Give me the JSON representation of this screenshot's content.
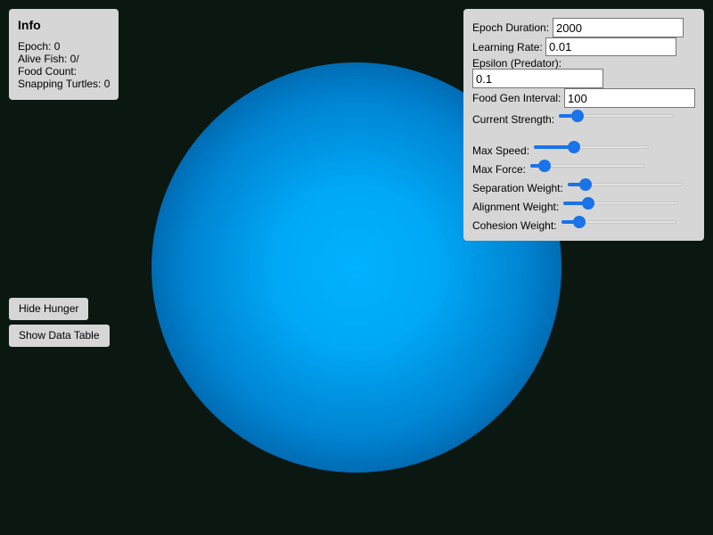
{
  "info": {
    "title": "Info",
    "epoch": "Epoch: 0",
    "alive_fish": "Alive Fish: 0/",
    "food_count": "Food Count:",
    "snapping_turtles": "Snapping Turtles: 0"
  },
  "controls": {
    "epoch_duration": {
      "label": "Epoch Duration:",
      "value": "2000"
    },
    "learning_rate": {
      "label": "Learning Rate:",
      "value": "0.01"
    },
    "epsilon": {
      "label": "Epsilon (Predator):",
      "value": "0.1"
    },
    "food_gen_interval": {
      "label": "Food Gen Interval:",
      "value": "100"
    },
    "current_strength": {
      "label": "Current Strength:",
      "level": 0.12
    },
    "max_speed": {
      "label": "Max Speed:",
      "level": 0.33
    },
    "max_force": {
      "label": "Max Force:",
      "level": 0.08
    },
    "separation_weight": {
      "label": "Separation Weight:",
      "level": 0.11
    },
    "alignment_weight": {
      "label": "Alignment Weight:",
      "level": 0.18
    },
    "cohesion_weight": {
      "label": "Cohesion Weight:",
      "level": 0.11
    }
  },
  "buttons": {
    "hide_hunger": "Hide Hunger",
    "show_data_table": "Show Data Table"
  },
  "colors": {
    "background": "#0b1812",
    "pond_center": "#00b2ff",
    "pond_edge": "#003770",
    "panel": "#d6d6d6",
    "accent": "#1a73e8"
  }
}
